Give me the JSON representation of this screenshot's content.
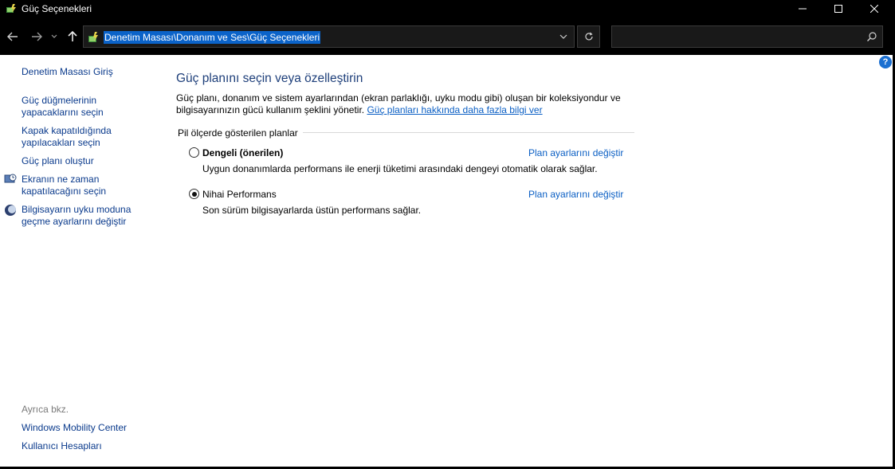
{
  "window": {
    "title": "Güç Seçenekleri",
    "minimize_glyph": "—",
    "maximize_glyph": "☐",
    "close_glyph": "✕"
  },
  "nav": {
    "address": "Denetim Masası\\Donanım ve Ses\\Güç Seçenekleri",
    "search_placeholder": ""
  },
  "sidebar": {
    "home": "Denetim Masası Giriş",
    "items": [
      "Güç düğmelerinin yapacaklarını seçin",
      "Kapak kapatıldığında yapılacakları seçin",
      "Güç planı oluştur",
      "Ekranın ne zaman kapatılacağını seçin",
      "Bilgisayarın uyku moduna geçme ayarlarını değiştir"
    ],
    "see_also_label": "Ayrıca bkz.",
    "see_also": [
      "Windows Mobility Center",
      "Kullanıcı Hesapları"
    ]
  },
  "main": {
    "title": "Güç planını seçin veya özelleştirin",
    "description": "Güç planı, donanım ve sistem ayarlarından (ekran parlaklığı, uyku modu gibi) oluşan bir koleksiyondur ve bilgisayarınızın gücü kullanım şeklini yönetir.",
    "learn_more_link": "Güç planları hakkında daha fazla bilgi ver",
    "group_label": "Pil ölçerde gösterilen planlar",
    "plans": [
      {
        "name": "Dengeli (önerilen)",
        "description": "Uygun donanımlarda performans ile enerji tüketimi arasındaki dengeyi otomatik olarak sağlar.",
        "link": "Plan ayarlarını değiştir",
        "selected": false
      },
      {
        "name": "Nihai Performans",
        "description": "Son sürüm bilgisayarlarda üstün performans sağlar.",
        "link": "Plan ayarlarını değiştir",
        "selected": true
      }
    ],
    "help_glyph": "?"
  },
  "colors": {
    "link": "#0b5fc4",
    "title": "#1e3f7a",
    "selection": "#0b63c9"
  }
}
